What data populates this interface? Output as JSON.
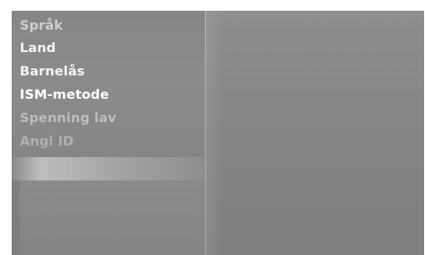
{
  "menu": {
    "items": [
      {
        "label": "Språk",
        "color": "#cfcfcf"
      },
      {
        "label": "Land",
        "color": "#f4f4f4"
      },
      {
        "label": "Barnelås",
        "color": "#f4f4f4"
      },
      {
        "label": "ISM-metode",
        "color": "#ffffff"
      },
      {
        "label": "Spenning lav",
        "color": "#bdbdbd"
      },
      {
        "label": "Angi ID",
        "color": "#b0b0b0"
      }
    ]
  }
}
